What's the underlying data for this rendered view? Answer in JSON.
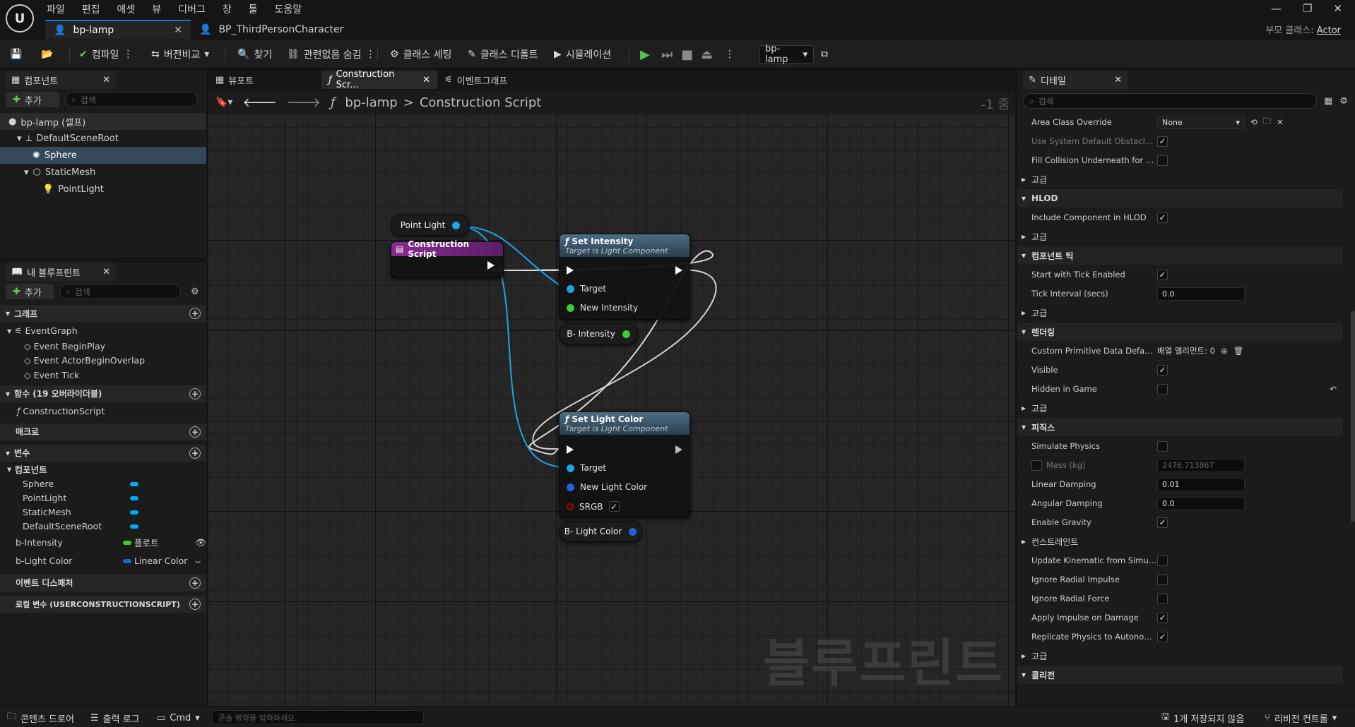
{
  "menu": [
    "파일",
    "편집",
    "에셋",
    "뷰",
    "디버그",
    "창",
    "툴",
    "도움말"
  ],
  "tabs": [
    {
      "label": "bp-lamp"
    },
    {
      "label": "BP_ThirdPersonCharacter"
    }
  ],
  "parent_class": {
    "label": "부모 클래스:",
    "value": "Actor"
  },
  "toolbar": {
    "compile": "컴파일",
    "diff": "버전비교",
    "find": "찾기",
    "hide_unrelated": "관련없음 숨김",
    "class_settings": "클래스 세팅",
    "class_defaults": "클래스 디폴트",
    "simulation": "시뮬레이션",
    "debug_object": "bp-lamp"
  },
  "components": {
    "title": "컴포넌트",
    "add": "추가",
    "search_placeholder": "검색",
    "items": [
      {
        "label": "bp-lamp (셀프)"
      },
      {
        "label": "DefaultSceneRoot"
      },
      {
        "label": "Sphere"
      },
      {
        "label": "StaticMesh"
      },
      {
        "label": "PointLight"
      }
    ]
  },
  "mybp": {
    "title": "내 블루프린트",
    "add": "추가",
    "search_placeholder": "검색",
    "graphs": "그래프",
    "eventgraph": "EventGraph",
    "events": [
      "Event BeginPlay",
      "Event ActorBeginOverlap",
      "Event Tick"
    ],
    "functions": "함수 (19 오버라이더블)",
    "construction": "ConstructionScript",
    "macros": "매크로",
    "variables": "변수",
    "components_group": "컴포넌트",
    "comp_vars": [
      "Sphere",
      "PointLight",
      "StaticMesh",
      "DefaultSceneRoot"
    ],
    "vars": [
      {
        "name": "b-Intensity",
        "type": "플로트"
      },
      {
        "name": "b-Light Color",
        "type": "Linear Color"
      }
    ],
    "dispatchers": "이벤트 디스패처",
    "local_vars": "로컬 변수 (USERCONSTRUCTIONSCRIPT)"
  },
  "graph_tabs": [
    "뷰포트",
    "Construction Scr...",
    "이벤트그래프"
  ],
  "breadcrumb": {
    "root": "bp-lamp",
    "sep": ">",
    "current": "Construction Script",
    "zoom": "-1 줌"
  },
  "nodes": {
    "point_light": "Point Light",
    "construction_script": "Construction Script",
    "set_intensity": {
      "title": "Set Intensity",
      "subtitle": "Target is Light Component",
      "target": "Target",
      "input": "New Intensity"
    },
    "b_intensity": "B- Intensity",
    "set_light_color": {
      "title": "Set Light Color",
      "subtitle": "Target is Light Component",
      "target": "Target",
      "input": "New Light Color",
      "srgb": "SRGB"
    },
    "b_light_color": "B- Light Color"
  },
  "watermark": "블루프린트",
  "details": {
    "title": "디테일",
    "search_placeholder": "검색",
    "rows": [
      {
        "label": "Area Class Override",
        "value": "None",
        "kind": "combo"
      },
      {
        "label": "Use System Default Obstacle...",
        "kind": "check",
        "checked": true,
        "dim": true
      },
      {
        "label": "Fill Collision Underneath for N...",
        "kind": "check",
        "checked": false
      },
      {
        "label": "고급",
        "kind": "sub"
      },
      {
        "label": "HLOD",
        "kind": "cat"
      },
      {
        "label": "Include Component in HLOD",
        "kind": "check",
        "checked": true
      },
      {
        "label": "고급",
        "kind": "sub"
      },
      {
        "label": "컴포넌트 틱",
        "kind": "cat"
      },
      {
        "label": "Start with Tick Enabled",
        "kind": "check",
        "checked": true
      },
      {
        "label": "Tick Interval (secs)",
        "value": "0.0",
        "kind": "num"
      },
      {
        "label": "고급",
        "kind": "sub"
      },
      {
        "label": "렌더링",
        "kind": "cat"
      },
      {
        "label": "Custom Primitive Data Defaults",
        "value": "배열 엘리먼트: 0",
        "kind": "arr"
      },
      {
        "label": "Visible",
        "kind": "check",
        "checked": true
      },
      {
        "label": "Hidden in Game",
        "kind": "check",
        "checked": false,
        "reset": true
      },
      {
        "label": "고급",
        "kind": "sub"
      },
      {
        "label": "피직스",
        "kind": "cat"
      },
      {
        "label": "Simulate Physics",
        "kind": "check",
        "checked": false
      },
      {
        "label": "Mass (kg)",
        "value": "2476.713867",
        "kind": "massnum"
      },
      {
        "label": "Linear Damping",
        "value": "0.01",
        "kind": "num"
      },
      {
        "label": "Angular Damping",
        "value": "0.0",
        "kind": "num"
      },
      {
        "label": "Enable Gravity",
        "kind": "check",
        "checked": true
      },
      {
        "label": "컨스트레인트",
        "kind": "sub"
      },
      {
        "label": "Update Kinematic from Simul...",
        "kind": "check",
        "checked": false
      },
      {
        "label": "Ignore Radial Impulse",
        "kind": "check",
        "checked": false
      },
      {
        "label": "Ignore Radial Force",
        "kind": "check",
        "checked": false
      },
      {
        "label": "Apply Impulse on Damage",
        "kind": "check",
        "checked": true
      },
      {
        "label": "Replicate Physics to Autonom...",
        "kind": "check",
        "checked": true
      },
      {
        "label": "고급",
        "kind": "sub"
      },
      {
        "label": "콜리전",
        "kind": "cat"
      }
    ]
  },
  "status": {
    "content_drawer": "콘텐츠 드로어",
    "output_log": "출력 로그",
    "cmd": "Cmd",
    "cmd_placeholder": "콘솔 명령을 입력하세요.",
    "unsaved": "1개 저장되지 않음",
    "revision": "리비전 컨트롤"
  },
  "colors": {
    "accent": "#0e7dd8",
    "float_pin": "#3ccf2e",
    "object_pin": "#00a8f3",
    "struct_pin": "#1f62d8",
    "bool_pin": "#b30000"
  }
}
